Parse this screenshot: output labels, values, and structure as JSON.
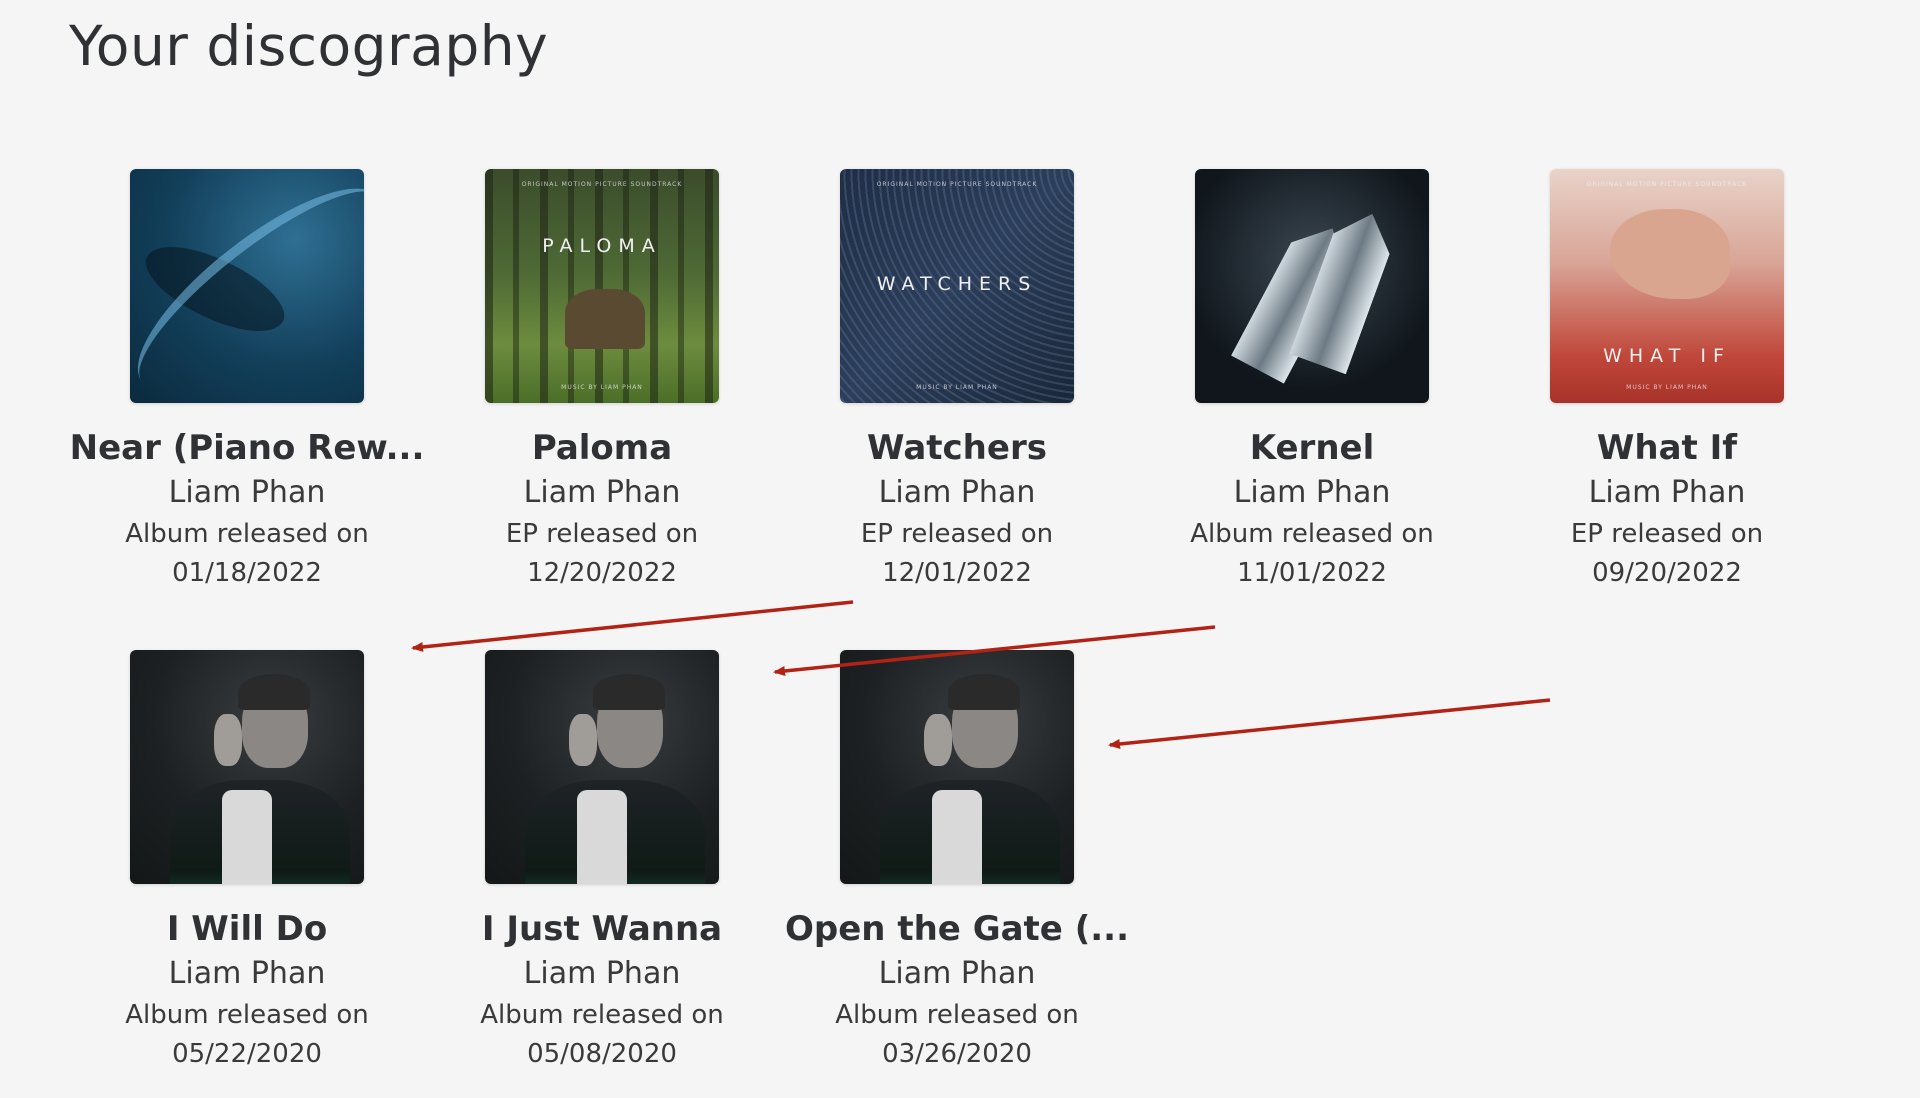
{
  "page": {
    "title": "Your discography"
  },
  "colors": {
    "arrow": "#b32315",
    "background": "#f5f5f5"
  },
  "releases": [
    {
      "title": "Near (Piano Rew...",
      "artist": "Liam Phan",
      "type": "Album released on",
      "date": "01/18/2022",
      "cover": "feather-cover"
    },
    {
      "title": "Paloma",
      "artist": "Liam Phan",
      "type": "EP released on",
      "date": "12/20/2022",
      "cover": "forest-cover",
      "cover_text": "PALOMA",
      "cover_top": "ORIGINAL MOTION PICTURE SOUNDTRACK",
      "cover_bottom": "MUSIC BY LIAM PHAN"
    },
    {
      "title": "Watchers",
      "artist": "Liam Phan",
      "type": "EP released on",
      "date": "12/01/2022",
      "cover": "lines-cover",
      "cover_text": "WATCHERS",
      "cover_top": "ORIGINAL MOTION PICTURE SOUNDTRACK",
      "cover_bottom": "MUSIC BY LIAM PHAN"
    },
    {
      "title": "Kernel",
      "artist": "Liam Phan",
      "type": "Album released on",
      "date": "11/01/2022",
      "cover": "crystal-cover"
    },
    {
      "title": "What If",
      "artist": "Liam Phan",
      "type": "EP released on",
      "date": "09/20/2022",
      "cover": "hand-cover",
      "cover_text": "WHAT IF",
      "cover_top": "ORIGINAL MOTION PICTURE SOUNDTRACK",
      "cover_bottom": "MUSIC BY LIAM PHAN"
    },
    {
      "title": "I Will Do",
      "artist": "Liam Phan",
      "type": "Album released on",
      "date": "05/22/2020",
      "cover": "portrait-cover"
    },
    {
      "title": "I Just Wanna",
      "artist": "Liam Phan",
      "type": "Album released on",
      "date": "05/08/2020",
      "cover": "portrait-cover"
    },
    {
      "title": "Open the Gate (...",
      "artist": "Liam Phan",
      "type": "Album released on",
      "date": "03/26/2020",
      "cover": "portrait-cover"
    }
  ]
}
